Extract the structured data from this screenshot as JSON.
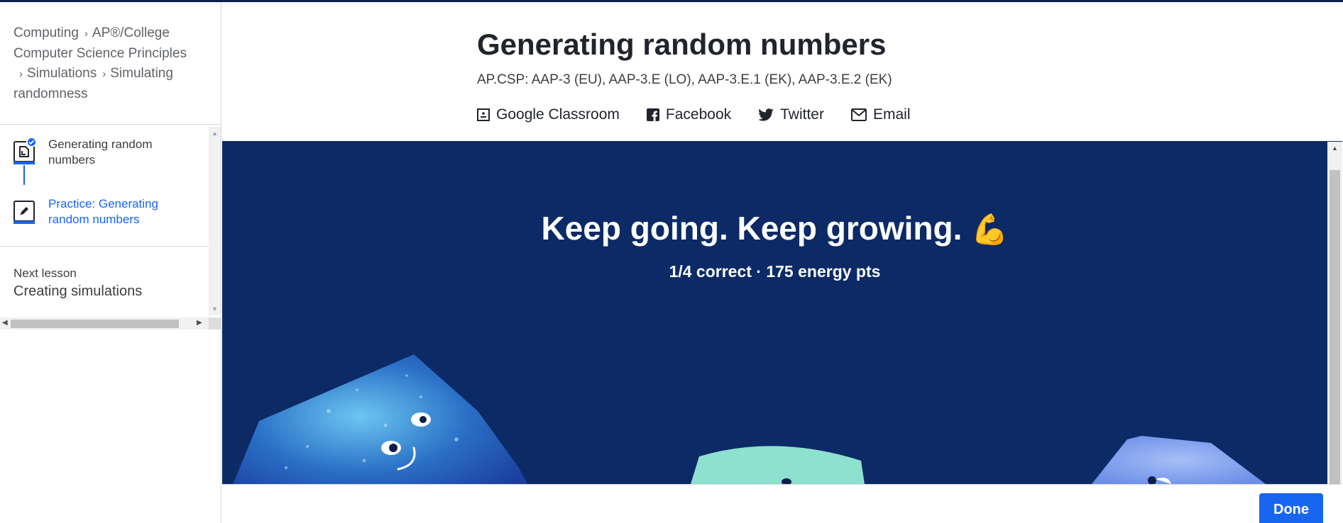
{
  "breadcrumb": {
    "items": [
      "Computing",
      "AP®/College Computer Science Principles",
      "Simulations",
      "Simulating randomness"
    ],
    "separator": "›"
  },
  "sidebar": {
    "lessons": [
      {
        "label": "Generating random numbers",
        "status": "completed",
        "icon": "article-icon"
      },
      {
        "label": "Practice: Generating random numbers",
        "status": "current",
        "icon": "pencil-icon"
      }
    ],
    "next_lesson": {
      "caption": "Next lesson",
      "title": "Creating simulations"
    }
  },
  "header": {
    "title": "Generating random numbers",
    "standards": "AP.CSP: AAP-3 (EU), AAP-3.E (LO), AAP-3.E.1 (EK), AAP-3.E.2 (EK)"
  },
  "share": {
    "google_classroom": "Google Classroom",
    "facebook": "Facebook",
    "twitter": "Twitter",
    "email": "Email"
  },
  "result": {
    "message": "Keep going. Keep growing.",
    "emoji": "💪",
    "score": "1/4 correct · 175 energy pts"
  },
  "footer": {
    "done_label": "Done"
  },
  "colors": {
    "accent": "#1865f2",
    "panel_bg": "#0c2a66",
    "top_rule": "#0b2149"
  }
}
